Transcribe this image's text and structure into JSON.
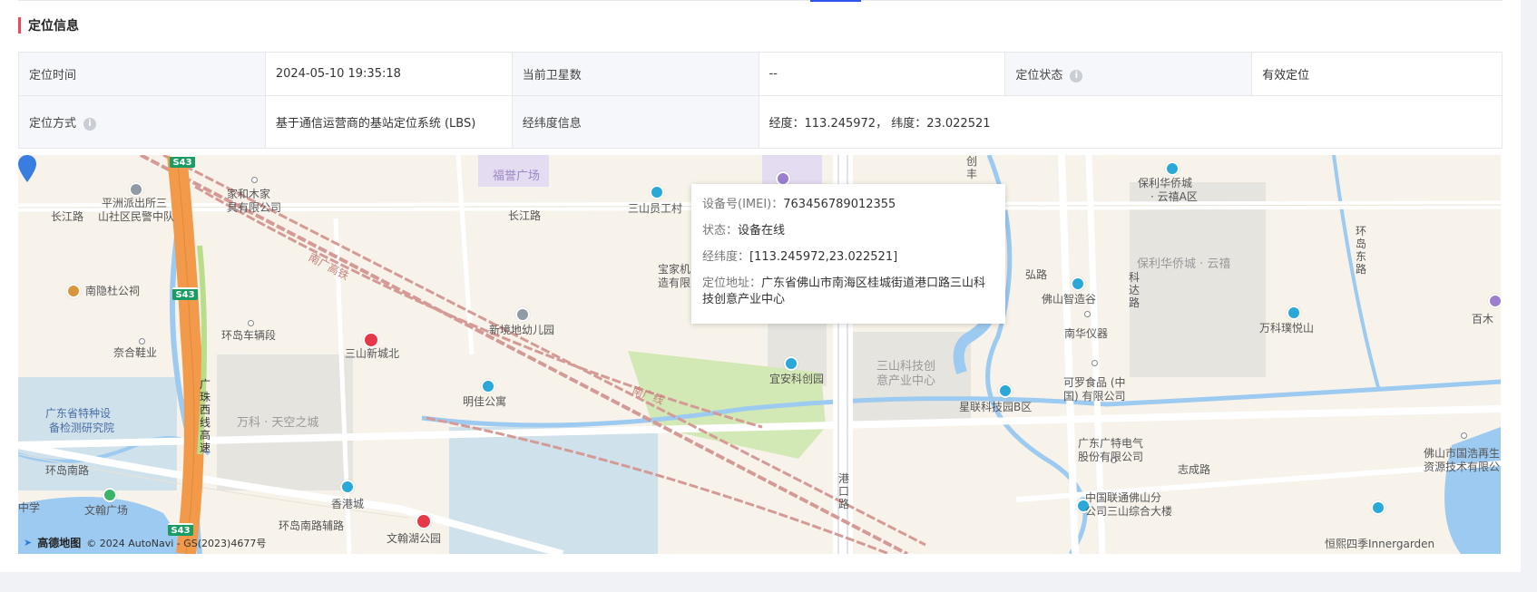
{
  "section": {
    "title": "定位信息"
  },
  "info": {
    "row1": [
      {
        "label": "定位时间",
        "value": "2024-05-10 19:35:18"
      },
      {
        "label": "当前卫星数",
        "value": "--"
      },
      {
        "label": "定位状态",
        "value": "有效定位",
        "help": "i"
      }
    ],
    "row2": {
      "method_label": "定位方式",
      "method_help": "i",
      "method_value": "基于通信运营商的基站定位系统 (LBS)",
      "lnglat_label": "经纬度信息",
      "lnglat_value": "经度：113.245972， 纬度：23.022521"
    }
  },
  "popup": {
    "imei_label": "设备号(IMEI)：",
    "imei_value": "763456789012355",
    "status_label": "状态：",
    "status_value": "设备在线",
    "lnglat_label": "经纬度：",
    "lnglat_value": "[113.245972,23.022521]",
    "address_label": "定位地址：",
    "address_value": "广东省佛山市南海区桂城街道港口路三山科技创意产业中心"
  },
  "map": {
    "labels": {
      "l1": "平洲派出所三",
      "l1b": "山社区民警中队",
      "l2": "长江路",
      "l3": "家和木家",
      "l3b": "具有限公司",
      "l4": "福誉广场",
      "l5": "三山员工村",
      "l6": "长江路",
      "l7": "宝家机",
      "l7b": "造有限",
      "l8": "南隐杜公祠",
      "l9": "环岛车辆段",
      "l10": "奈合鞋业",
      "l11": "三山新城北",
      "l12": "新境地幼儿园",
      "l13": "明佳公寓",
      "l14": "广东省特种设",
      "l14b": "备检测研究院",
      "l15": "万科 · 天空之城",
      "l16": "环岛南路",
      "l17": "文翰广场",
      "l18": "香港城",
      "l19": "环岛南路辅路",
      "l20": "文翰湖公园",
      "l21": "宜安科创园",
      "l22": "三山科技创",
      "l22b": "意产业中心",
      "l23": "港口路",
      "l24": "保利华侨城",
      "l24b": "· 云禧A区",
      "l25": "保利华侨城 · 云禧",
      "l26": "佛山智造谷",
      "l27": "南华仪器",
      "l28": "可罗食品 (中",
      "l28b": "国) 有限公司",
      "l29": "星联科技园B区",
      "l30": "广东广特电气",
      "l30b": "股份有限公司",
      "l31": "志成路",
      "l32": "中国联通佛山分",
      "l32b": "公司三山综合大楼",
      "l33": "万科璞悦山",
      "l34": "环岛东路",
      "l35": "百木",
      "l36": "佛山市国浩再生",
      "l36b": "资源技术有限公司",
      "l37": "恒熙四季Innergarden",
      "l38": "科达路",
      "l39": "广珠西线高速",
      "l40": "南广高铁",
      "l41": "南广线",
      "l42": "创丰",
      "l43": "弘路",
      "l44": "中学"
    },
    "shields": [
      "S43",
      "S43",
      "S43"
    ],
    "attribution_logo": "高德地图",
    "attribution_text": "© 2024 AutoNavi - GS(2023)4677号"
  }
}
